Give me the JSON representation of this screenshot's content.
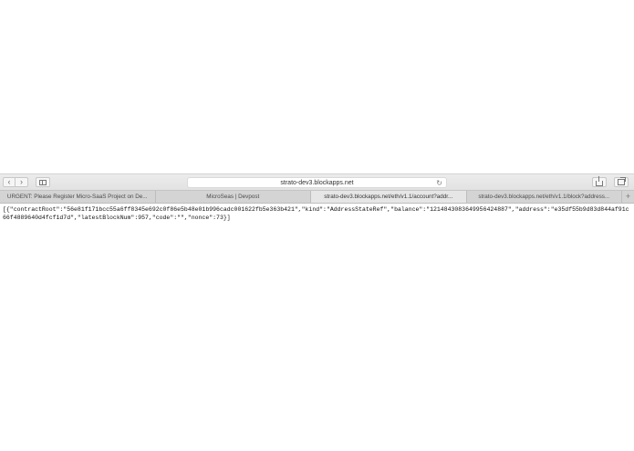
{
  "browser": {
    "address": "strato-dev3.blockapps.net",
    "icons": {
      "back": "chevron-left-icon",
      "forward": "chevron-right-icon",
      "sidebar": "sidebar-icon",
      "reload": "reload-icon",
      "share": "share-icon",
      "tabs": "tabs-overview-icon",
      "new_tab": "plus-icon"
    }
  },
  "tabs": [
    {
      "label": "URGENT: Please Register Micro-SaaS Project on De...",
      "active": false
    },
    {
      "label": "MicroSeas | Devpost",
      "active": false
    },
    {
      "label": "strato-dev3.blockapps.net/eth/v1.1/account?addr...",
      "active": true
    },
    {
      "label": "strato-dev3.blockapps.net/eth/v1.1/block?address...",
      "active": false
    }
  ],
  "content": {
    "json": "[{\"contractRoot\":\"56e81f171bcc55a6ff8345e692c0f86e5b48e01b996cadc001622fb5e363b421\",\"kind\":\"AddressStateRef\",\"balance\":\"1214843083649956424887\",\"address\":\"e35df55b9d83d844af91c66f4889640d4fcf1d7d\",\"latestBlockNum\":957,\"code\":\"\",\"nonce\":73}]"
  }
}
